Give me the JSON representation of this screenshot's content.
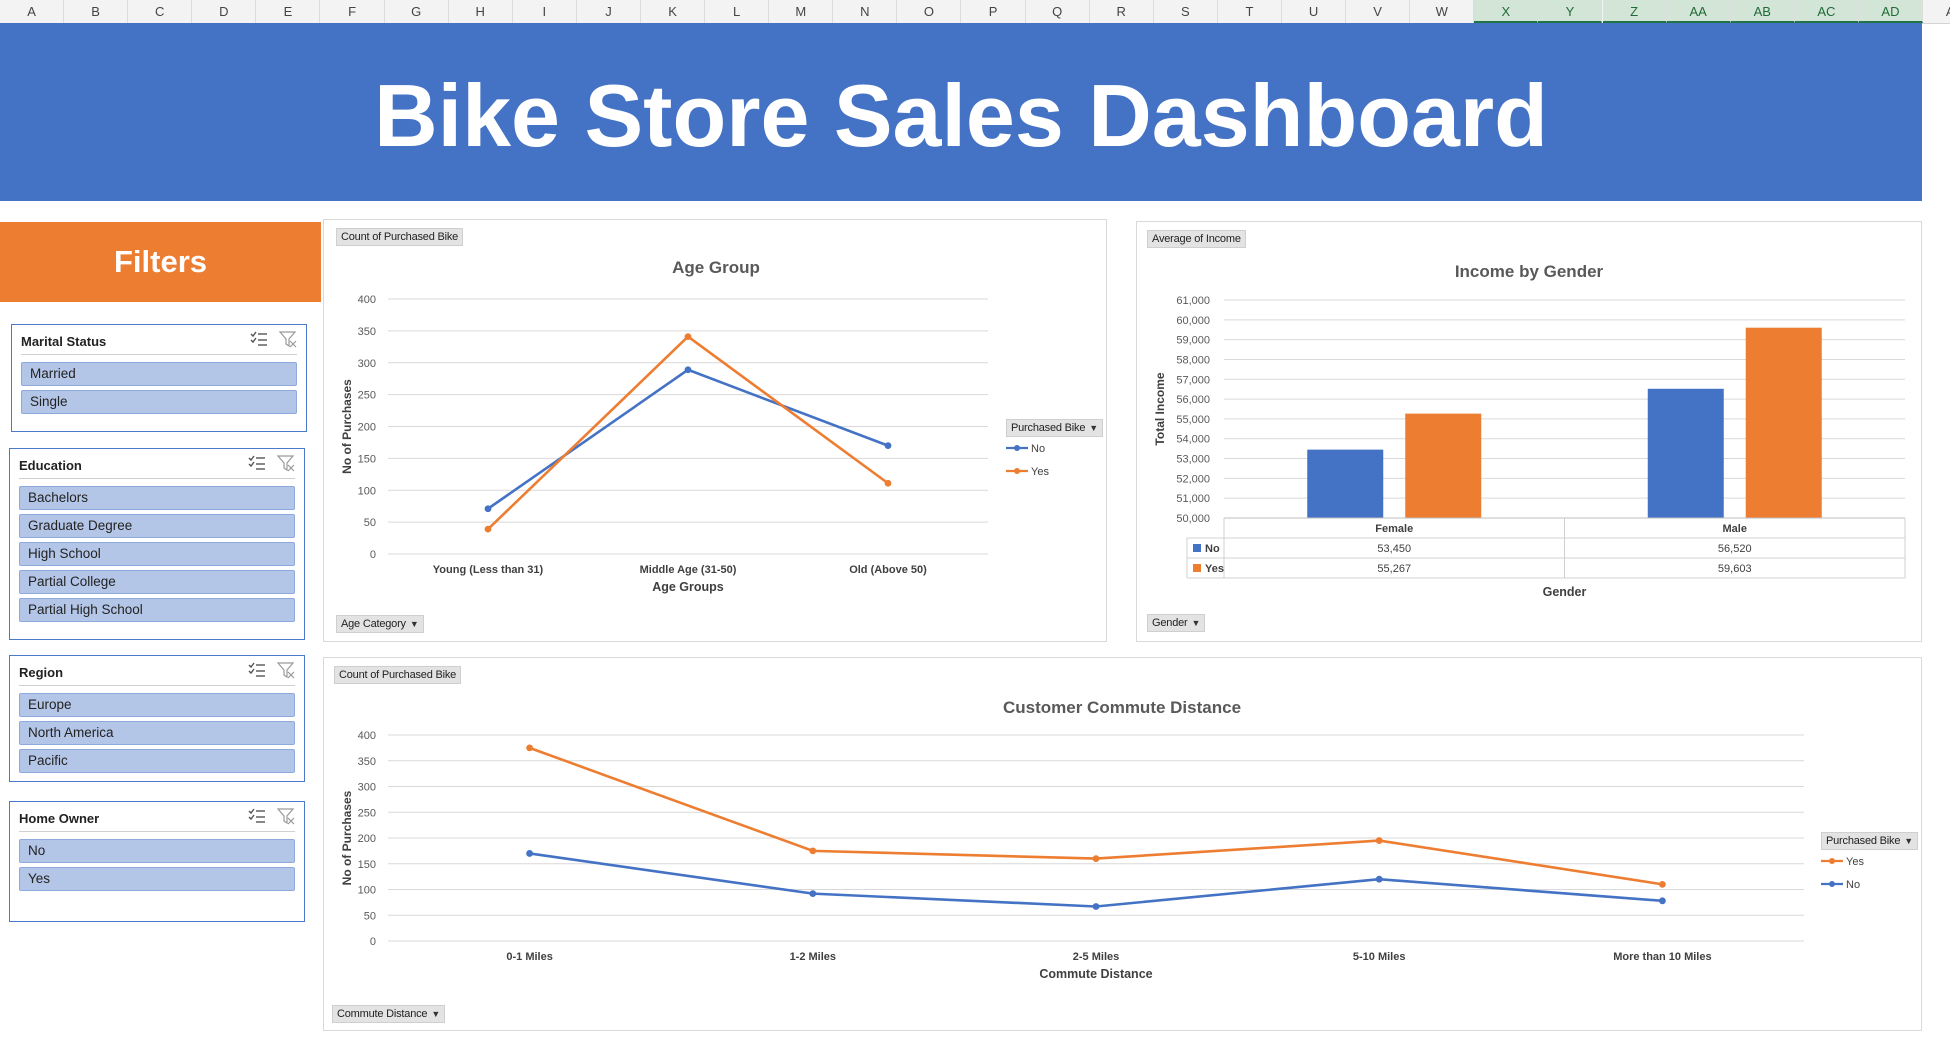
{
  "columns": [
    "A",
    "B",
    "C",
    "D",
    "E",
    "F",
    "G",
    "H",
    "I",
    "J",
    "K",
    "L",
    "M",
    "N",
    "O",
    "P",
    "Q",
    "R",
    "S",
    "T",
    "U",
    "V",
    "W",
    "X",
    "Y",
    "Z",
    "AA",
    "AB",
    "AC",
    "AD",
    "AE"
  ],
  "selected_columns": [
    "X",
    "Y",
    "Z",
    "AA",
    "AB",
    "AC",
    "AD"
  ],
  "title": "Bike Store Sales Dashboard",
  "filters_title": "Filters",
  "slicers": [
    {
      "title": "Marital Status",
      "items": [
        "Married",
        "Single"
      ]
    },
    {
      "title": "Education",
      "items": [
        "Bachelors",
        "Graduate Degree",
        "High School",
        "Partial College",
        "Partial High School"
      ]
    },
    {
      "title": "Region",
      "items": [
        "Europe",
        "North America",
        "Pacific"
      ]
    },
    {
      "title": "Home Owner",
      "items": [
        "No",
        "Yes"
      ]
    }
  ],
  "colors": {
    "banner": "#4472c4",
    "filters": "#ed7d31",
    "series_no": "#4472c4",
    "series_yes": "#ed7d31",
    "slicer_item": "#b4c6e7"
  },
  "icons": {
    "multi_select": "multi-select-icon",
    "clear_filter": "clear-filter-icon",
    "dropdown": "dropdown-arrow-icon"
  },
  "chart_data": [
    {
      "id": "age",
      "type": "line",
      "field_value": "Count of Purchased Bike",
      "field_axis": "Age Category",
      "legend_title": "Purchased Bike",
      "title": "Age Group",
      "xlabel": "Age Groups",
      "ylabel": "No of Purchases",
      "categories": [
        "Young (Less than 31)",
        "Middle Age (31-50)",
        "Old (Above 50)"
      ],
      "ylim": [
        0,
        400
      ],
      "yticks": [
        "0",
        "50",
        "100",
        "150",
        "200",
        "250",
        "300",
        "350",
        "400"
      ],
      "series": [
        {
          "name": "No",
          "color": "#4472c4",
          "values": [
            71,
            289,
            170
          ]
        },
        {
          "name": "Yes",
          "color": "#ed7d31",
          "values": [
            39,
            341,
            111
          ]
        }
      ]
    },
    {
      "id": "income",
      "type": "bar",
      "field_value": "Average of Income",
      "field_axis": "Gender",
      "title": "Income by Gender",
      "xlabel": "Gender",
      "ylabel": "Total Income",
      "categories": [
        "Female",
        "Male"
      ],
      "ylim": [
        50000,
        61000
      ],
      "yticks": [
        "50,000",
        "51,000",
        "52,000",
        "53,000",
        "54,000",
        "55,000",
        "56,000",
        "57,000",
        "58,000",
        "59,000",
        "60,000",
        "61,000"
      ],
      "series": [
        {
          "name": "No",
          "color": "#4472c4",
          "values": [
            53450,
            56520
          ],
          "labels": [
            "53,450",
            "56,520"
          ]
        },
        {
          "name": "Yes",
          "color": "#ed7d31",
          "values": [
            55267,
            59603
          ],
          "labels": [
            "55,267",
            "59,603"
          ]
        }
      ]
    },
    {
      "id": "commute",
      "type": "line",
      "field_value": "Count of Purchased Bike",
      "field_axis": "Commute Distance",
      "legend_title": "Purchased Bike",
      "title": "Customer Commute Distance",
      "xlabel": "Commute Distance",
      "ylabel": "No of Purchases",
      "categories": [
        "0-1 Miles",
        "1-2 Miles",
        "2-5 Miles",
        "5-10 Miles",
        "More than 10 Miles"
      ],
      "ylim": [
        0,
        400
      ],
      "yticks": [
        "0",
        "50",
        "100",
        "150",
        "200",
        "250",
        "300",
        "350",
        "400"
      ],
      "series": [
        {
          "name": "Yes",
          "color": "#ed7d31",
          "values": [
            375,
            175,
            160,
            195,
            110
          ]
        },
        {
          "name": "No",
          "color": "#4472c4",
          "values": [
            170,
            92,
            67,
            120,
            78
          ]
        }
      ]
    }
  ]
}
